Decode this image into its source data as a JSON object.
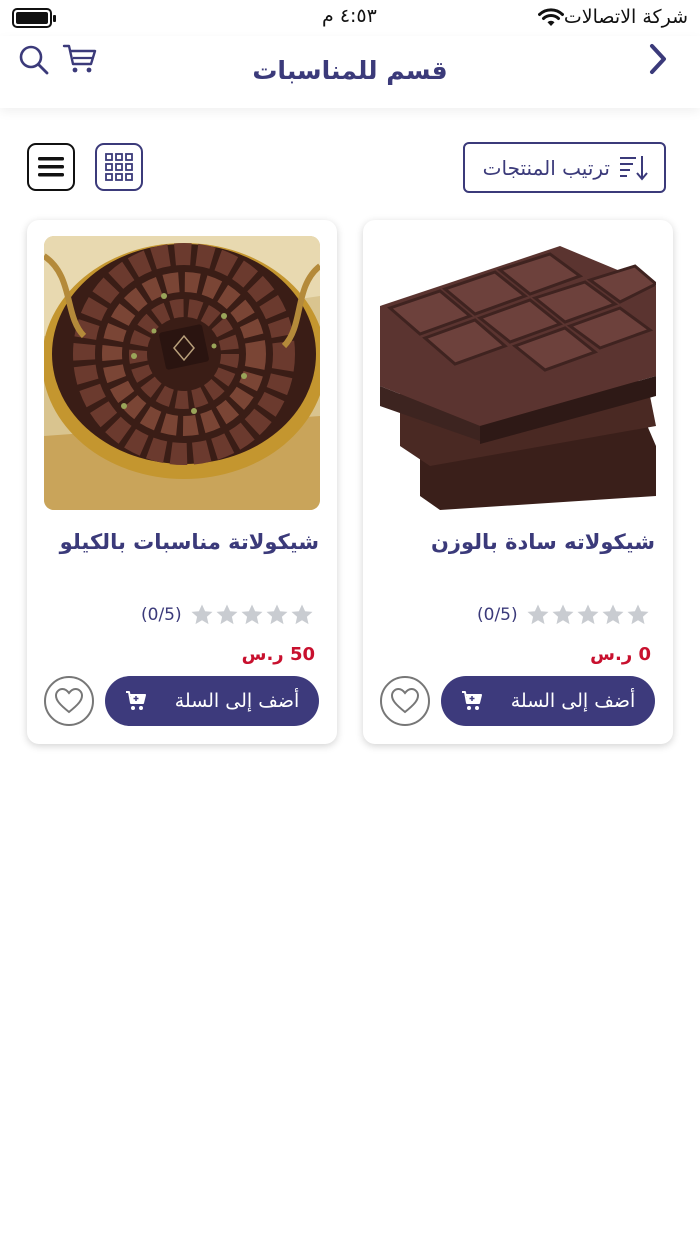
{
  "status_bar": {
    "carrier": "شركة الاتصالات",
    "time": "٤:٥٣ م"
  },
  "header": {
    "title": "قسم للمناسبات"
  },
  "toolbar": {
    "sort_label": "ترتيب المنتجات"
  },
  "products": [
    {
      "name": "شيكولاته سادة بالوزن",
      "rating_text": "(0/5)",
      "rating": 0,
      "price": "0 ر.س",
      "add_to_cart_label": "أضف إلى السلة"
    },
    {
      "name": "شيكولاتة مناسبات بالكيلو",
      "rating_text": "(0/5)",
      "rating": 0,
      "price": "50 ر.س",
      "add_to_cart_label": "أضف إلى السلة"
    }
  ],
  "colors": {
    "brand": "#3b3a7a",
    "price": "#c8102e",
    "star_inactive": "#c9ccd1"
  },
  "icons": [
    "battery-icon",
    "wifi-icon",
    "back-icon",
    "search-icon",
    "cart-icon",
    "sort-icon",
    "grid-view-icon",
    "list-view-icon",
    "star-icon",
    "cart-add-icon",
    "heart-icon"
  ]
}
